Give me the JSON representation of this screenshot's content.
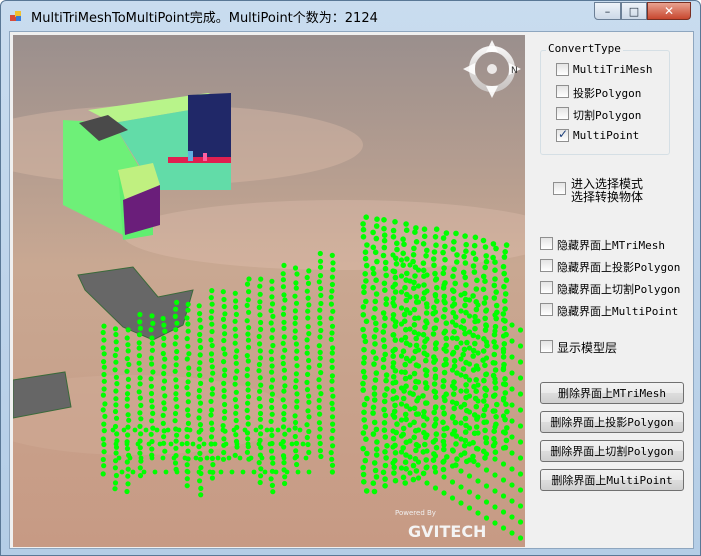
{
  "window": {
    "title": "MultiTriMeshToMultiPoint完成。MultiPoint个数为：2124",
    "controls": {
      "minimize": "–",
      "maximize": "□",
      "close": "✕"
    }
  },
  "viewport": {
    "compass_label": "N",
    "watermark": {
      "powered_by": "Powered By",
      "brand": "GVITECH"
    }
  },
  "convert_type": {
    "title": "ConvertType",
    "options": [
      {
        "label": "MultiTriMesh",
        "checked": false
      },
      {
        "label": "投影Polygon",
        "checked": false
      },
      {
        "label": "切割Polygon",
        "checked": false
      },
      {
        "label": "MultiPoint",
        "checked": true
      }
    ]
  },
  "select_mode": {
    "line1": "进入选择模式",
    "line2": "选择转换物体",
    "checked": false
  },
  "hide_options": [
    {
      "label": "隐藏界面上MTriMesh",
      "checked": false
    },
    {
      "label": "隐藏界面上投影Polygon",
      "checked": false
    },
    {
      "label": "隐藏界面上切割Polygon",
      "checked": false
    },
    {
      "label": "隐藏界面上MultiPoint",
      "checked": false
    }
  ],
  "show_model_layer": {
    "label": "显示模型层",
    "checked": false
  },
  "buttons": {
    "delete_mtrimesh": "删除界面上MTriMesh",
    "delete_projection_polygon": "删除界面上投影Polygon",
    "delete_cut_polygon": "删除界面上切割Polygon",
    "delete_multipoint": "删除界面上MultiPoint"
  },
  "colors": {
    "points": "#00ff00",
    "sky_top": "#9a8f8d",
    "sky_bottom": "#d6a88b"
  }
}
